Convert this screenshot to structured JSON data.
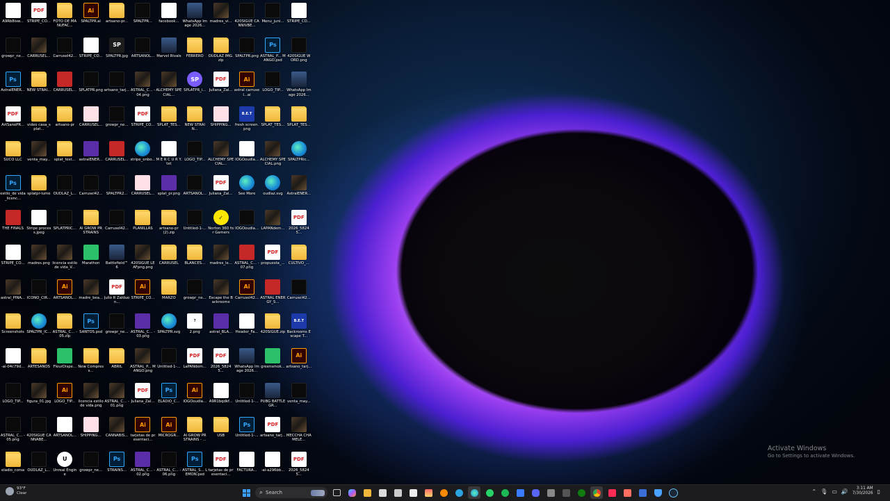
{
  "desktop": {
    "icons": [
      {
        "label": "A9Rb8isw...",
        "type": "doc"
      },
      {
        "label": "STRIPE_CO...",
        "type": "pdf"
      },
      {
        "label": "FOTO DE MANUFAC...",
        "type": "folder"
      },
      {
        "label": "SPALTPR.ai",
        "type": "ai"
      },
      {
        "label": "artsano-pr...",
        "type": "folder"
      },
      {
        "label": "SPALTPR...",
        "type": "dark"
      },
      {
        "label": "facebook...",
        "type": "doc"
      },
      {
        "label": "WhatsApp Image 2026...",
        "type": "game"
      },
      {
        "label": "madres_vi...",
        "type": "img"
      },
      {
        "label": "420SIGUE CANNIVBE...",
        "type": "dark"
      },
      {
        "label": "Menu_juni...",
        "type": "dark"
      },
      {
        "label": "STRIPE_CO...",
        "type": "doc"
      },
      {
        "label": "growpr_ne...",
        "type": "dark"
      },
      {
        "label": "CARRUSEL...",
        "type": "img"
      },
      {
        "label": "Carrusel42...",
        "type": "dark"
      },
      {
        "label": "STRIPE_CO...",
        "type": "doc"
      },
      {
        "label": "SPALTPR.jpg",
        "type": "sp"
      },
      {
        "label": "ARTSANOL...",
        "type": "dark"
      },
      {
        "label": "Marvel Rivals",
        "type": "game"
      },
      {
        "label": "FEBRERO",
        "type": "folder"
      },
      {
        "label": "OUDLAZ IMG.zip",
        "type": "folder"
      },
      {
        "label": "SPALTPR.png",
        "type": "dark"
      },
      {
        "label": "ASTRAL_P... MANGO.psd",
        "type": "ps"
      },
      {
        "label": "420SIGUE WORD.png",
        "type": "dark"
      },
      {
        "label": "AstralENER...",
        "type": "ps"
      },
      {
        "label": "NEW STRAI...",
        "type": "folder"
      },
      {
        "label": "CARRUSEL...",
        "type": "red"
      },
      {
        "label": "SPLATPR.png",
        "type": "dark"
      },
      {
        "label": "artsano_tarj...",
        "type": "dark"
      },
      {
        "label": "ASTRAL_C... -04.png",
        "type": "img"
      },
      {
        "label": "ALCHEMY SPECIAL...",
        "type": "img"
      },
      {
        "label": "SPLATPR_i...",
        "type": "aibl"
      },
      {
        "label": "Juliana_Zal...",
        "type": "pdf"
      },
      {
        "label": "astral carrusel...ai",
        "type": "ai"
      },
      {
        "label": "LOGO_TIP...",
        "type": "dark"
      },
      {
        "label": "WhatsApp Image 2026...",
        "type": "game"
      },
      {
        "label": "ArtSanoPR...",
        "type": "pdf"
      },
      {
        "label": "video casa_splat...",
        "type": "folder"
      },
      {
        "label": "artsano-pr",
        "type": "folder"
      },
      {
        "label": "CARRUSEL...",
        "type": "pink"
      },
      {
        "label": "growpr_ne...",
        "type": "dark"
      },
      {
        "label": "STRIPE_CO...",
        "type": "pdf"
      },
      {
        "label": "SPLAT_TES...",
        "type": "folder"
      },
      {
        "label": "NEW STRAIN...",
        "type": "folder"
      },
      {
        "label": "SHIPPING...",
        "type": "pink"
      },
      {
        "label": "fresh screen.png",
        "type": "blue"
      },
      {
        "label": "SPLAT_TES...",
        "type": "folder"
      },
      {
        "label": "SPLAT_TES...",
        "type": "folder"
      },
      {
        "label": "SUCO LLC",
        "type": "folder"
      },
      {
        "label": "venta_may...",
        "type": "img"
      },
      {
        "label": "splat_test...",
        "type": "folder"
      },
      {
        "label": "astralENER...",
        "type": "purple"
      },
      {
        "label": "CARRUSEL...",
        "type": "red"
      },
      {
        "label": "stripe_onbo...",
        "type": "edge"
      },
      {
        "label": "M E R C U R Y.txt",
        "type": "doc"
      },
      {
        "label": "LOGO_TIP...",
        "type": "dark"
      },
      {
        "label": "ALCHEMY SPECIAL...",
        "type": "img"
      },
      {
        "label": "IOGOoudla...",
        "type": "doc"
      },
      {
        "label": "ALCHEMY SPECIAL.png",
        "type": "img"
      },
      {
        "label": "SPALTPRic...",
        "type": "edge"
      },
      {
        "label": "estilo_de vida_licenc...",
        "type": "ps"
      },
      {
        "label": "splatpr-lume",
        "type": "folder"
      },
      {
        "label": "OUDLAZ_L...",
        "type": "dark"
      },
      {
        "label": "Carrusel42...",
        "type": "dark"
      },
      {
        "label": "SPALTPR2...",
        "type": "dark"
      },
      {
        "label": "CARRUSEL...",
        "type": "pink"
      },
      {
        "label": "splat_pr.png",
        "type": "purple"
      },
      {
        "label": "ARTSANOL...",
        "type": "dark"
      },
      {
        "label": "Juliana_Zal...",
        "type": "pdf"
      },
      {
        "label": "See More",
        "type": "edge"
      },
      {
        "label": "oudlaz.svg",
        "type": "edge"
      },
      {
        "label": "AstralENER...",
        "type": "img"
      },
      {
        "label": "THE FINALS",
        "type": "red"
      },
      {
        "label": "Stripe process.jpeg",
        "type": "doc"
      },
      {
        "label": "SPLATPRIC...",
        "type": "dark"
      },
      {
        "label": "AI GROW PR STRAINS",
        "type": "folder"
      },
      {
        "label": "Carrusel42...",
        "type": "dark"
      },
      {
        "label": "PLANILLAS",
        "type": "folder"
      },
      {
        "label": "artsano-pr (2).zip",
        "type": "folder"
      },
      {
        "label": "Untitled-1-...",
        "type": "dark"
      },
      {
        "label": "Norton 360 for Gamers",
        "type": "norton"
      },
      {
        "label": "IOGOoudla...",
        "type": "dark"
      },
      {
        "label": "LAPANdem...",
        "type": "img"
      },
      {
        "label": "2026_58245...",
        "type": "pdf"
      },
      {
        "label": "STRIPE_CO...",
        "type": "doc"
      },
      {
        "label": "madres.png",
        "type": "img"
      },
      {
        "label": "licencia estilo de vida_V...",
        "type": "img"
      },
      {
        "label": "Marathon",
        "type": "green"
      },
      {
        "label": "Battlefield™ 6",
        "type": "game"
      },
      {
        "label": "420SIGUE LEAFpng.png",
        "type": "img"
      },
      {
        "label": "CARRUSEL",
        "type": "folder"
      },
      {
        "label": "BLANCES...",
        "type": "folder"
      },
      {
        "label": "madres_le...",
        "type": "img"
      },
      {
        "label": "ASTRAL_C... -07.png",
        "type": "red"
      },
      {
        "label": "propuesta_...",
        "type": "pdf"
      },
      {
        "label": "CULTIVO_...",
        "type": "folder"
      },
      {
        "label": "astral_PINA...",
        "type": "img"
      },
      {
        "label": "ICONO_CIR...",
        "type": "dark"
      },
      {
        "label": "ARTSANOL...",
        "type": "ai"
      },
      {
        "label": "madre_bea...",
        "type": "img"
      },
      {
        "label": "Julio R Zalduon...",
        "type": "pdf"
      },
      {
        "label": "STRIPE_CO...",
        "type": "ai"
      },
      {
        "label": "MARZO",
        "type": "folder"
      },
      {
        "label": "growpr_ne...",
        "type": "dark"
      },
      {
        "label": "Escape the Backrooms",
        "type": "img"
      },
      {
        "label": "Carrusel42...",
        "type": "ai"
      },
      {
        "label": "ASTRAL ENERGY_S...",
        "type": "red"
      },
      {
        "label": "Carrusel42...",
        "type": "dark"
      },
      {
        "label": "Screenshots",
        "type": "folder"
      },
      {
        "label": "SPALTPR_IC...",
        "type": "edge"
      },
      {
        "label": "ASTRAL_C... -05.zip",
        "type": "folder"
      },
      {
        "label": "SANTOS.psd",
        "type": "ps"
      },
      {
        "label": "growpr_ne...",
        "type": "dark"
      },
      {
        "label": "ASTRAL_C... -03.png",
        "type": "purple"
      },
      {
        "label": "SPALTPR.svg",
        "type": "edge"
      },
      {
        "label": "2.png",
        "type": "txt"
      },
      {
        "label": "astral_BLA...",
        "type": "purple"
      },
      {
        "label": "Header_Fa...",
        "type": "doc"
      },
      {
        "label": "420SIGUE.zip",
        "type": "folder"
      },
      {
        "label": "Backrooms Escape T...",
        "type": "blue"
      },
      {
        "label": "-ai-04c79d...",
        "type": "doc"
      },
      {
        "label": "ARTESANOS",
        "type": "folder"
      },
      {
        "label": "FleurDispe...",
        "type": "green"
      },
      {
        "label": "New Compress...",
        "type": "folder"
      },
      {
        "label": "ABRIL",
        "type": "folder"
      },
      {
        "label": "ASTRAL_P... MANGO.png",
        "type": "img"
      },
      {
        "label": "Untitled-1-...",
        "type": "dark"
      },
      {
        "label": "LaPANdem...",
        "type": "pdf"
      },
      {
        "label": "2026_58245...",
        "type": "pdf"
      },
      {
        "label": "WhatsApp Image 2026...",
        "type": "game"
      },
      {
        "label": "greensmok...",
        "type": "green"
      },
      {
        "label": "artsano_tarj...",
        "type": "ai"
      },
      {
        "label": "LOGO_TIP...",
        "type": "dark"
      },
      {
        "label": "figura_01.jpg",
        "type": "img"
      },
      {
        "label": "LOGO_TIP...",
        "type": "ai"
      },
      {
        "label": "licencia estilo de vida.png",
        "type": "img"
      },
      {
        "label": "ASTRAL_C... -01.png",
        "type": "img"
      },
      {
        "label": "Juliana_Zal...",
        "type": "pdf"
      },
      {
        "label": "ELADIO_C...",
        "type": "ps"
      },
      {
        "label": "IOGOoudla...",
        "type": "ai"
      },
      {
        "label": "A9R1bqdkf...",
        "type": "doc"
      },
      {
        "label": "Untitled-1-...",
        "type": "dark"
      },
      {
        "label": "PUBG BATTLEGR...",
        "type": "game"
      },
      {
        "label": "venta_may...",
        "type": "dark"
      },
      {
        "label": "ASTRAL_C... -05.png",
        "type": "dark"
      },
      {
        "label": "420SIGUE CANNABE...",
        "type": "dark"
      },
      {
        "label": "ARTSANOL...",
        "type": "doc"
      },
      {
        "label": "SHIPPING...",
        "type": "pink"
      },
      {
        "label": "CANNABIS...",
        "type": "img"
      },
      {
        "label": "tarjetas de presentaci...",
        "type": "ai"
      },
      {
        "label": "MICROGR...",
        "type": "ai"
      },
      {
        "label": "AI GROW PR STRAINS - ...",
        "type": "folder"
      },
      {
        "label": "USB",
        "type": "folder"
      },
      {
        "label": "Untitled-1-...",
        "type": "ps"
      },
      {
        "label": "artsano_tarj...",
        "type": "pdf"
      },
      {
        "label": "MECCHA CHAMELE...",
        "type": "img"
      },
      {
        "label": "eladio_corsa",
        "type": "folder"
      },
      {
        "label": "OUDLAZ_L...",
        "type": "dark"
      },
      {
        "label": "Unreal Engine",
        "type": "ueng"
      },
      {
        "label": "growpr_ne...",
        "type": "dark"
      },
      {
        "label": "STRAINS...",
        "type": "ps"
      },
      {
        "label": "ASTRAL_C... -02.png",
        "type": "purple"
      },
      {
        "label": "ASTRAL_C... -06.png",
        "type": "dark"
      },
      {
        "label": "ASTRAL_S... LEMON.psd",
        "type": "ps"
      },
      {
        "label": "tarjetas de presentaci...",
        "type": "pdf"
      },
      {
        "label": "FACTURA...",
        "type": "doc"
      },
      {
        "label": "-ai-a296bb...",
        "type": "doc"
      },
      {
        "label": "2026_58245...",
        "type": "pdf"
      },
      {
        "label": "cannabisp...",
        "type": "img"
      },
      {
        "label": "Pitch_ArtS...",
        "type": "pdf"
      },
      {
        "label": "FACTURA_...",
        "type": "doc"
      },
      {
        "label": "2026_58245...",
        "type": "pdf"
      },
      {
        "label": "Untitled-1-...",
        "type": "dark"
      },
      {
        "label": "SANTOS_",
        "type": "folder"
      }
    ]
  },
  "icon_glyphs": {
    "pdf": "PDF",
    "ai": "Ai",
    "ps": "Ps",
    "sp": "SP",
    "norton": "✓",
    "ueng": "U",
    "aibl": "SP",
    "blue": "B.E.T",
    "txt": "?"
  },
  "watermark": {
    "line1": "Activate Windows",
    "line2": "Go to Settings to activate Windows."
  },
  "taskbar": {
    "weather_temp": "93°F",
    "weather_desc": "Clear",
    "search_placeholder": "Search",
    "apps": [
      "file-explorer",
      "edge",
      "chrome",
      "spotify",
      "discord",
      "steam",
      "xbox",
      "tiktok",
      "telegram",
      "whatsapp"
    ],
    "clock_time": "3:11 AM",
    "clock_date": "7/30/2026"
  },
  "colors": {
    "taskbar": "#1c1c1e",
    "accent": "#3aa0ff"
  }
}
